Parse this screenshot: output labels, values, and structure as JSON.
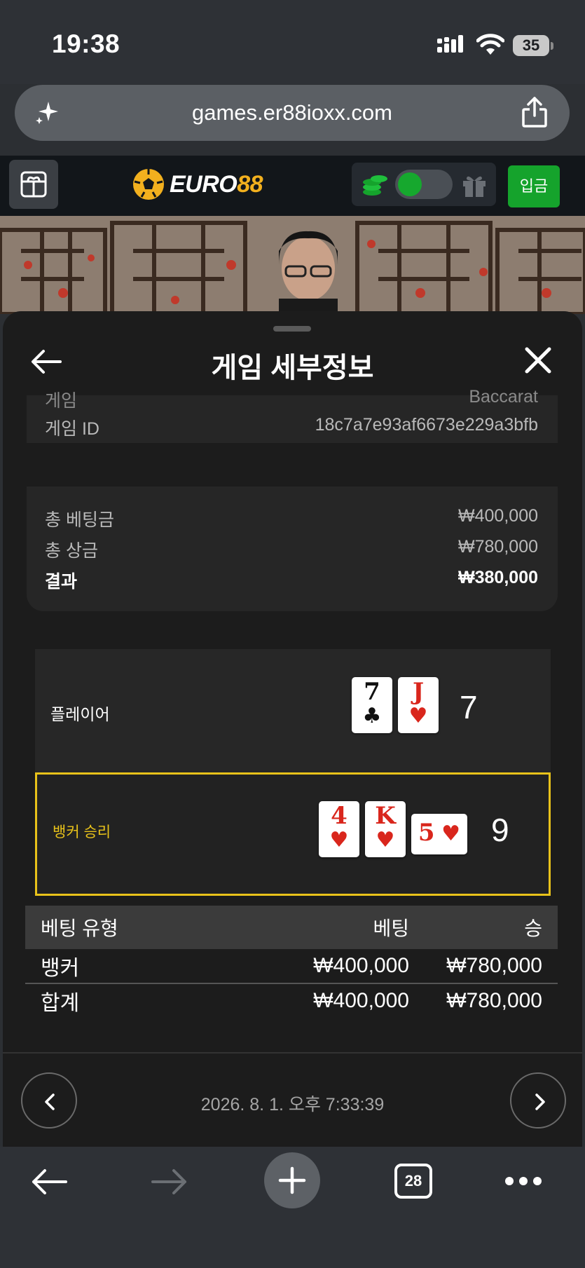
{
  "status_bar": {
    "time": "19:38",
    "battery": "35"
  },
  "browser": {
    "url": "games.er88ioxx.com",
    "tab_count": "28"
  },
  "app_header": {
    "logo_text_white": "EURO",
    "logo_text_gold": "88",
    "deposit_label": "입금"
  },
  "sheet": {
    "title": "게임 세부정보",
    "info": [
      {
        "label": "게임",
        "value": "Baccarat"
      },
      {
        "label": "게임 ID",
        "value": "18c7a7e93af6673e229a3bfb"
      }
    ],
    "totals": [
      {
        "label": "총 베팅금",
        "value": "₩400,000"
      },
      {
        "label": "총 상금",
        "value": "₩780,000"
      },
      {
        "label": "결과",
        "value": "₩380,000"
      }
    ],
    "outcome": {
      "player": {
        "label": "플레이어",
        "cards": [
          {
            "rank": "7",
            "suit": "♣"
          },
          {
            "rank": "J",
            "suit": "♥"
          }
        ],
        "score": "7"
      },
      "banker": {
        "label": "뱅커 승리",
        "cards": [
          {
            "rank": "4",
            "suit": "♥"
          },
          {
            "rank": "K",
            "suit": "♥"
          },
          {
            "rank": "5",
            "suit": "♥"
          }
        ],
        "score": "9"
      }
    },
    "bet_table": {
      "headers": [
        "베팅 유형",
        "베팅",
        "승"
      ],
      "rows": [
        [
          "뱅커",
          "₩400,000",
          "₩780,000"
        ]
      ],
      "total": [
        "합계",
        "₩400,000",
        "₩780,000"
      ]
    },
    "timestamp": "2026. 8. 1. 오후 7:33:39"
  },
  "colors": {
    "accent_green": "#15a32c",
    "gold": "#f2b01e",
    "winner_border": "#e8c21a",
    "suit_red": "#d9261c"
  }
}
